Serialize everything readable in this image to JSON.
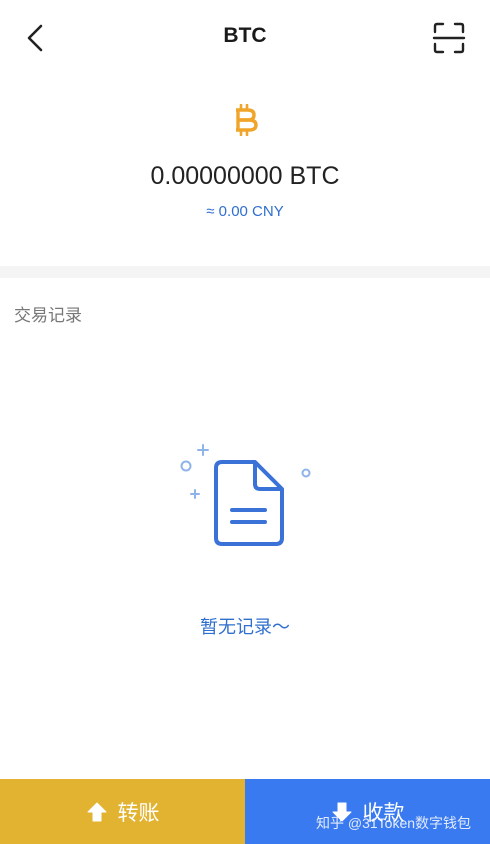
{
  "header": {
    "title": "BTC",
    "back_icon": "chevron-left-icon",
    "scan_icon": "scan-icon"
  },
  "asset": {
    "coin_icon": "bitcoin-icon",
    "coin_color": "#f0a52a",
    "balance": "0.00000000 BTC",
    "fiat_value": "≈ 0.00 CNY"
  },
  "transactions": {
    "section_title": "交易记录",
    "empty_icon": "document-icon",
    "empty_text": "暂无记录～"
  },
  "actions": {
    "transfer_label": "转账",
    "transfer_icon": "arrow-up-icon",
    "transfer_color": "#e2b231",
    "receive_label": "收款",
    "receive_icon": "arrow-down-icon",
    "receive_color": "#3a7af0"
  },
  "watermark": "知乎 @31Token数字钱包",
  "accent_color": "#2f6fcf"
}
